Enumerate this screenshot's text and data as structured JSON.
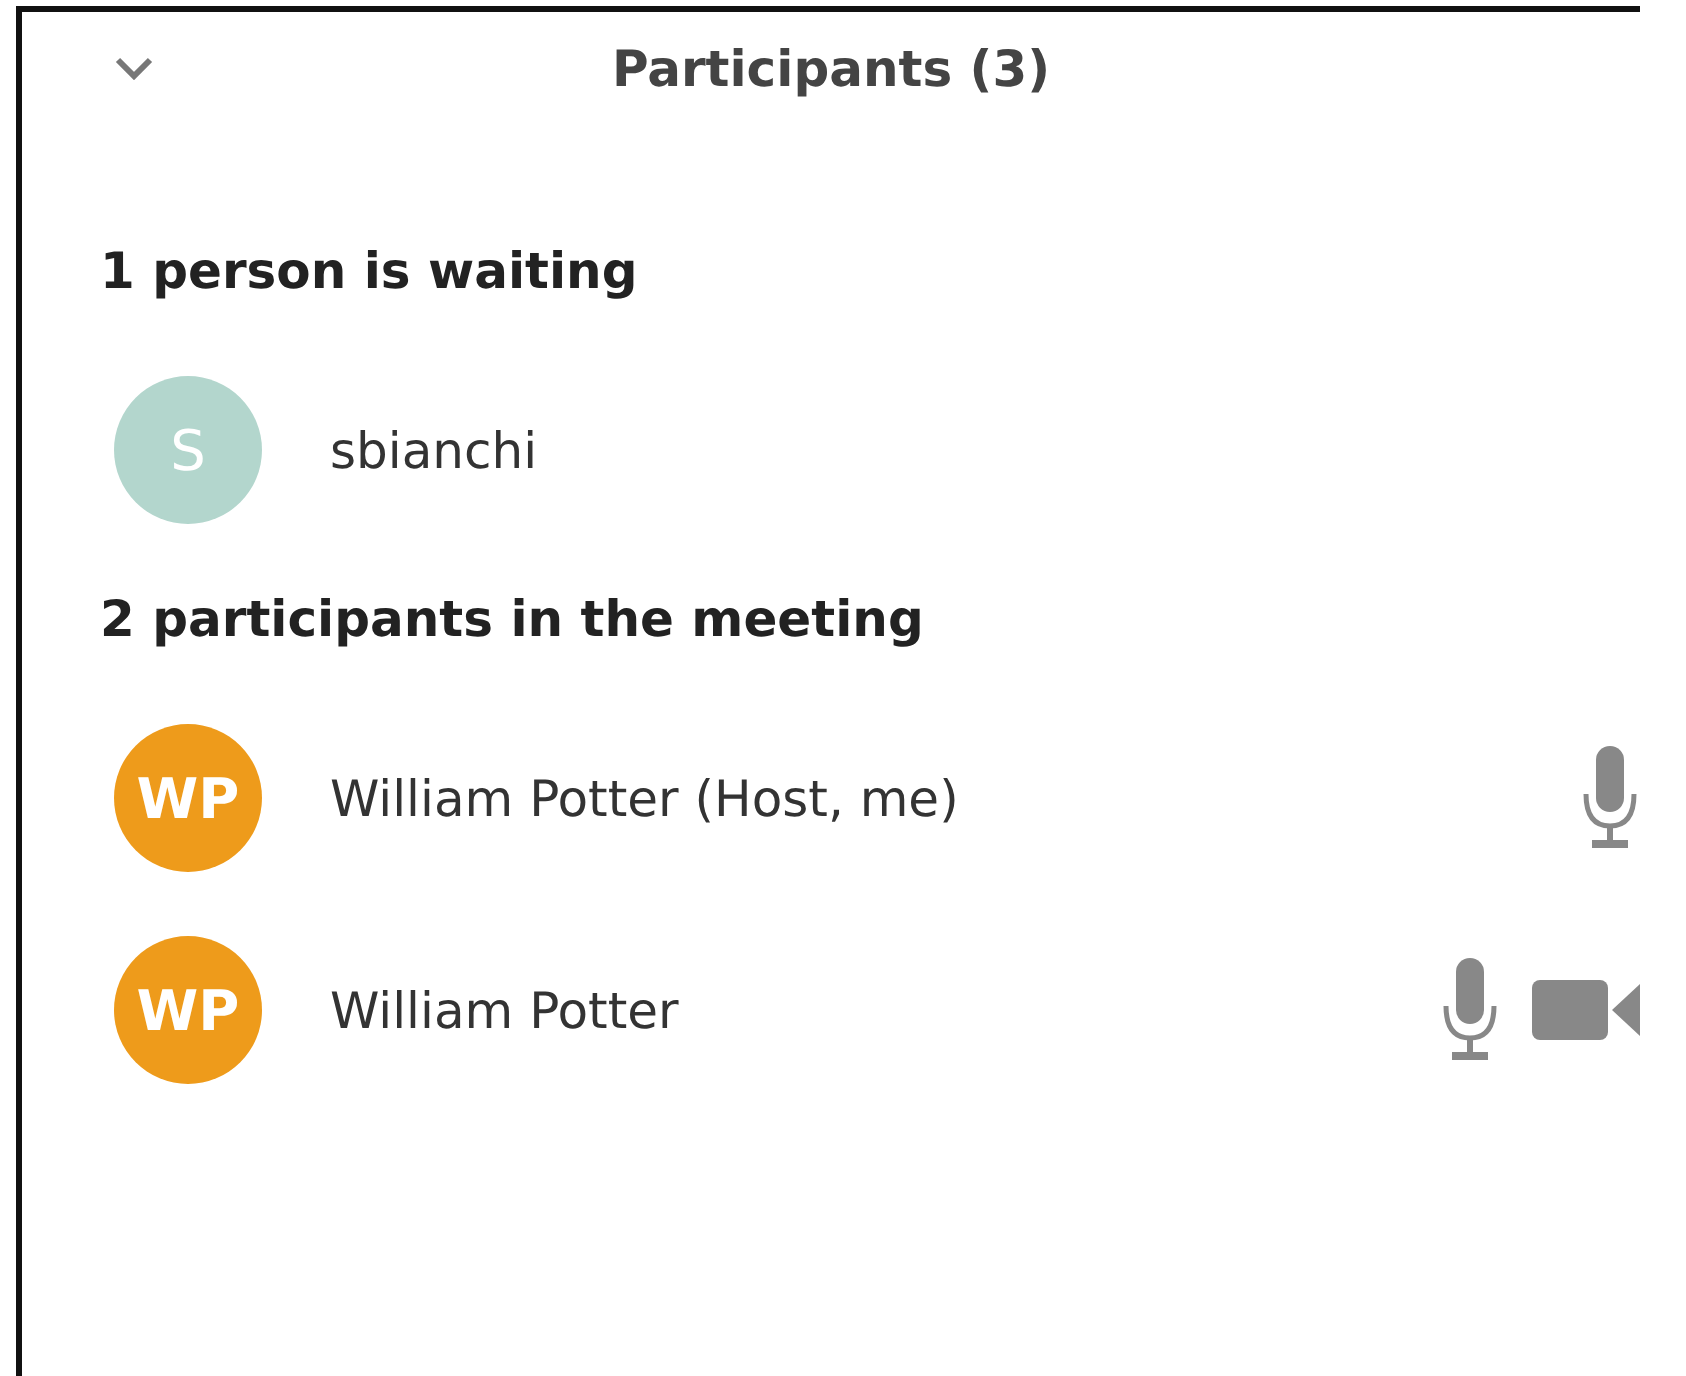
{
  "header": {
    "title": "Participants (3)",
    "collapse_icon": true
  },
  "sections": [
    {
      "heading": "1 person is waiting",
      "people": [
        {
          "initials": "S",
          "name": "sbianchi",
          "color": "#b3d6cd"
        }
      ]
    },
    {
      "heading": "2 participants in the meeting",
      "people": [
        {
          "initials": "WP",
          "name": "William Potter (Host, me)",
          "color": "#ee9b1b",
          "icons": [
            {
              "kind": "mic"
            }
          ]
        },
        {
          "initials": "WP",
          "name": "William Potter",
          "color": "#ee9b1b",
          "icons": [
            {
              "kind": "mic"
            },
            {
              "kind": "video"
            }
          ]
        }
      ]
    }
  ]
}
